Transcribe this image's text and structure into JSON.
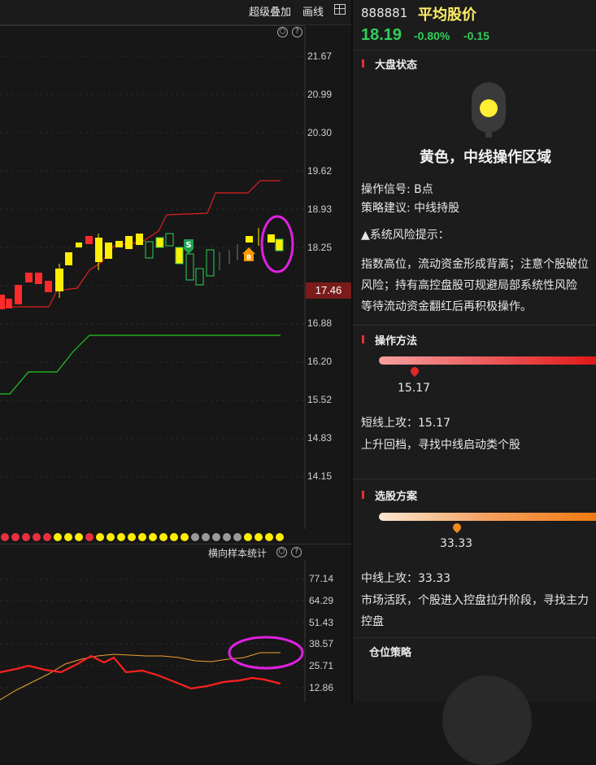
{
  "toolbar": {
    "super_overlay": "超级叠加",
    "draw": "画线"
  },
  "main_chart": {
    "y_ticks": [
      "21.67",
      "20.99",
      "20.30",
      "19.62",
      "18.93",
      "18.25",
      "17.46",
      "16.88",
      "16.20",
      "15.52",
      "14.83",
      "14.15"
    ],
    "current_price_tag": "17.46",
    "buy_signal_glyph": "S",
    "sell_signal_glyph": "B"
  },
  "sub_chart": {
    "title": "横向样本统计",
    "y_ticks": [
      "77.14",
      "64.29",
      "51.43",
      "38.57",
      "25.71",
      "12.86"
    ]
  },
  "stock": {
    "code": "888881",
    "name": "平均股价",
    "price": "18.19",
    "change_pct": "-0.80%",
    "change": "-0.15"
  },
  "market_state": {
    "title": "大盘状态",
    "status": "黄色，中线操作区域",
    "signal": "操作信号: B点",
    "advice": "策略建议: 中线持股",
    "risk_title": "▲系统风险提示：",
    "risk_lines": [
      "指数高位，流动资金形成背离；注意个股破位",
      "风险；持有高控盘股可规避局部系统性风险",
      "等待流动资金翻红后再积极操作。"
    ]
  },
  "operation": {
    "title": "操作方法",
    "gauge_value": "15.17",
    "line1": "短线上攻：15.17",
    "line2": "上升回档，寻找中线启动类个股"
  },
  "stock_picking": {
    "title": "选股方案",
    "gauge_value": "33.33",
    "line1": "中线上攻：33.33",
    "line2": "市场活跃，个股进入控盘拉升阶段，寻找主力",
    "line3": "控盘"
  },
  "position": {
    "title": "仓位策略"
  },
  "colors": {
    "up": "#ff2a2a",
    "down": "#2ed05a",
    "yellow": "#ffee00",
    "highlight": "#e020e0",
    "tag_bg": "#7a1c1c"
  },
  "chart_data": [
    {
      "type": "line",
      "title": "",
      "ylim": [
        13.8,
        22.0
      ],
      "series": [
        {
          "values": [
            17.6,
            17.8,
            17.9,
            18.0,
            18.1,
            18.2,
            18.0,
            18.4,
            18.5,
            18.6,
            18.4,
            18.3,
            18.2,
            18.2,
            18.3,
            18.2,
            18.1,
            18.3,
            18.4,
            18.3
          ]
        }
      ]
    },
    {
      "type": "line",
      "ylim": [
        0,
        90
      ],
      "y_ticks": [
        77.14,
        64.29,
        51.43,
        38.57,
        25.71,
        12.86
      ]
    }
  ]
}
